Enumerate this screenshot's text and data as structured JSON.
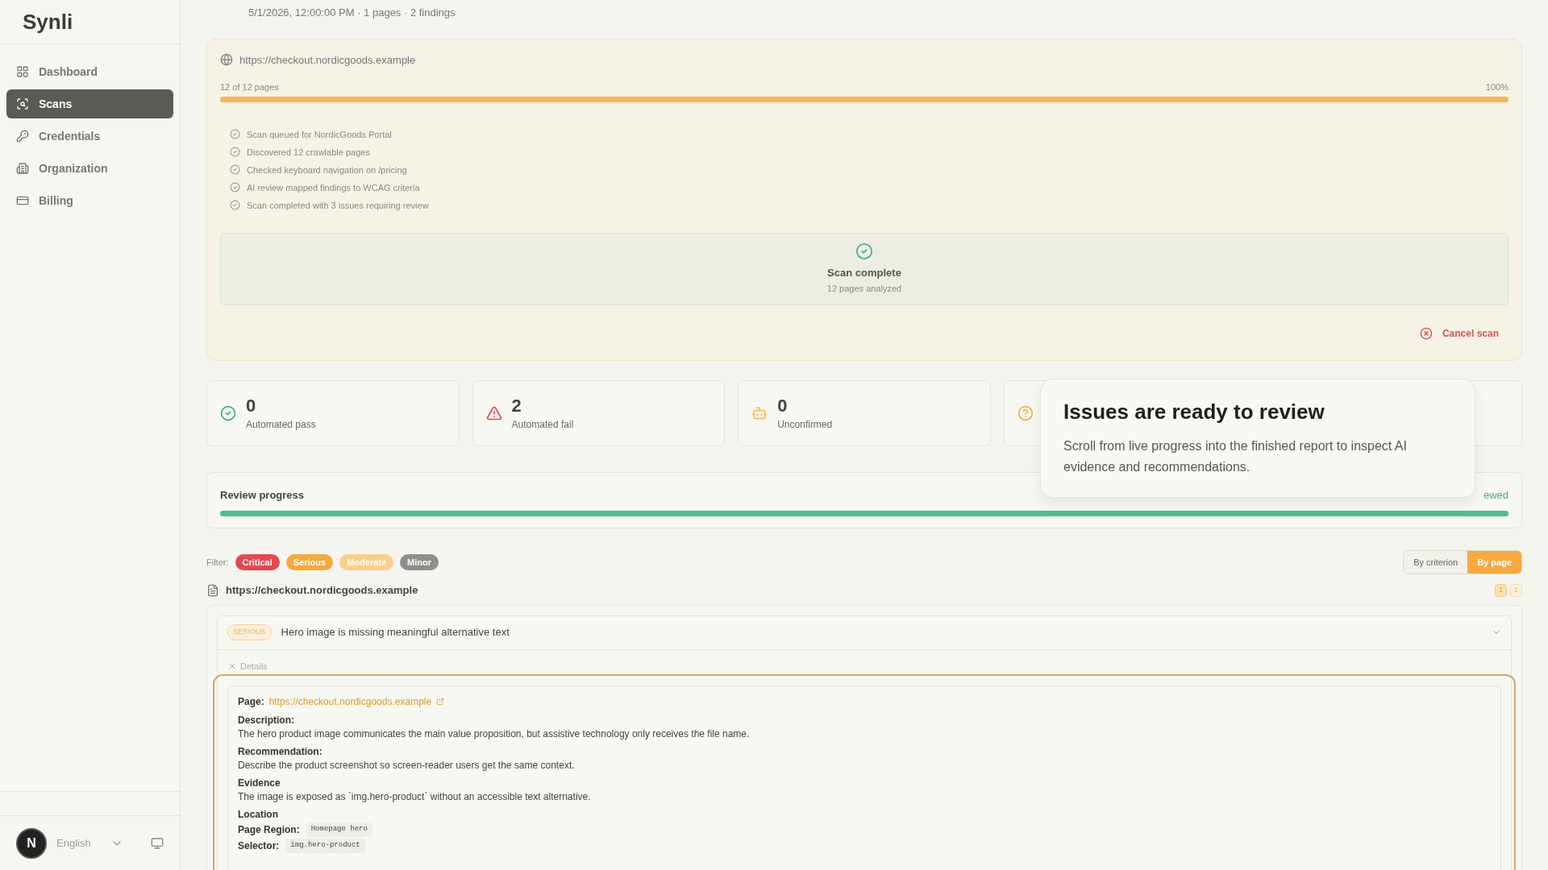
{
  "sidebar": {
    "logo": "Synli",
    "items": [
      {
        "label": "Dashboard",
        "selected": false
      },
      {
        "label": "Scans",
        "selected": true
      },
      {
        "label": "Credentials",
        "selected": false
      },
      {
        "label": "Organization",
        "selected": false
      },
      {
        "label": "Billing",
        "selected": false
      }
    ],
    "avatar": "N",
    "language": "English"
  },
  "header": {
    "subtitle": "5/1/2026, 12:00:00 PM · 1 pages · 2 findings"
  },
  "scan": {
    "url": "https://checkout.nordicgoods.example",
    "pages": "12 of 12 pages",
    "percent": "100%",
    "level": 1,
    "log": [
      "Scan queued for NordicGoods Portal",
      "Discovered 12 crawlable pages",
      "Checked keyboard navigation on /pricing",
      "AI review mapped findings to WCAG criteria",
      "Scan completed with 3 issues requiring review"
    ],
    "complete_title": "Scan complete",
    "complete_subtitle": "12 pages analyzed",
    "cancel": "Cancel scan"
  },
  "stats": [
    {
      "kind": "pass",
      "value": "0",
      "label": "Automated pass"
    },
    {
      "kind": "fail",
      "value": "2",
      "label": "Automated fail"
    },
    {
      "kind": "unconfirmed",
      "value": "0",
      "label": "Unconfirmed"
    },
    {
      "kind": "question"
    },
    {
      "kind": "empty"
    }
  ],
  "review": {
    "title": "Review progress",
    "status": "ewed",
    "level": 1
  },
  "tooltip": {
    "title": "Issues are ready to review",
    "body": "Scroll from live progress into the finished report to inspect AI evidence and recommendations."
  },
  "filter": {
    "label": "Filter:",
    "chips": [
      {
        "label": "Critical",
        "color": "#e5484d"
      },
      {
        "label": "Serious",
        "color": "#f5a93b"
      },
      {
        "label": "Moderate",
        "color": "#f9cf8c"
      },
      {
        "label": "Minor",
        "color": "#8f8f8a"
      }
    ]
  },
  "view_toggle": [
    {
      "label": "By criterion",
      "selected": false
    },
    {
      "label": "By page",
      "selected": true
    }
  ],
  "page_group": {
    "url": "https://checkout.nordicgoods.example",
    "counts": [
      "1",
      "1"
    ]
  },
  "issue": {
    "severity": "SERIOUS",
    "title": "Hero image is missing meaningful alternative text",
    "details_label": "Details",
    "page_label": "Page:",
    "page_url": "https://checkout.nordicgoods.example",
    "description_label": "Description:",
    "description": "The hero product image communicates the main value proposition, but assistive technology only receives the file name.",
    "recommendation_label": "Recommendation:",
    "recommendation": "Describe the product screenshot so screen-reader users get the same context.",
    "evidence_label": "Evidence",
    "evidence": "The image is exposed as `img.hero-product` without an accessible text alternative.",
    "location_label": "Location",
    "region_label": "Page Region:",
    "region": "Homepage hero",
    "selector_label": "Selector:",
    "selector": "img.hero-product"
  }
}
